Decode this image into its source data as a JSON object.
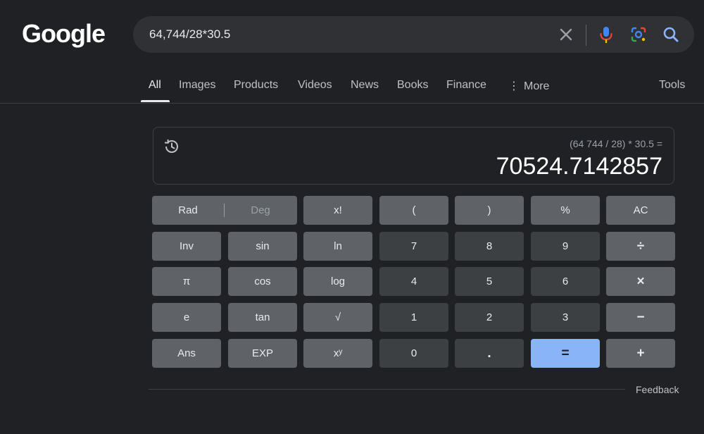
{
  "logo": "Google",
  "search": {
    "query": "64,744/28*30.5",
    "clear_icon": "close-icon",
    "voice_icon": "microphone-icon",
    "lens_icon": "camera-lens-icon",
    "search_icon": "search-icon"
  },
  "tabs": [
    {
      "label": "All"
    },
    {
      "label": "Images"
    },
    {
      "label": "Products"
    },
    {
      "label": "Videos"
    },
    {
      "label": "News"
    },
    {
      "label": "Books"
    },
    {
      "label": "Finance"
    },
    {
      "label": "More"
    }
  ],
  "tools_label": "Tools",
  "calculator": {
    "expression": "(64 744 / 28) * 30.5 =",
    "result": "70524.7142857",
    "history_icon": "history-icon",
    "rad_label": "Rad",
    "deg_label": "Deg",
    "keys": {
      "fact": "x!",
      "lparen": "(",
      "rparen": ")",
      "percent": "%",
      "ac": "AC",
      "inv": "Inv",
      "sin": "sin",
      "ln": "ln",
      "k7": "7",
      "k8": "8",
      "k9": "9",
      "div": "÷",
      "pi": "π",
      "cos": "cos",
      "log": "log",
      "k4": "4",
      "k5": "5",
      "k6": "6",
      "mul": "×",
      "e": "e",
      "tan": "tan",
      "sqrt": "√",
      "k1": "1",
      "k2": "2",
      "k3": "3",
      "minus": "−",
      "ans": "Ans",
      "exp": "EXP",
      "pow": "xʸ",
      "k0": "0",
      "dot": ".",
      "eq": "=",
      "plus": "+"
    }
  },
  "feedback_label": "Feedback",
  "colors": {
    "background": "#202124",
    "function_key": "#5f6368",
    "number_key": "#3c4043",
    "equals_key": "#8ab4f8"
  }
}
